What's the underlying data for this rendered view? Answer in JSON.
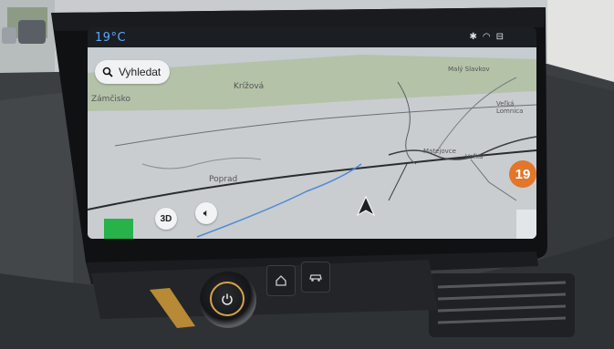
{
  "status_bar": {
    "temperature": "19°C",
    "icons": [
      "bluetooth-icon",
      "wifi-icon",
      "car-connect-icon"
    ]
  },
  "map": {
    "search_label": "Vyhledat",
    "place_labels": [
      "Zámčisko",
      "Krížová",
      "Malý Slavkov",
      "Veľká Lomnica",
      "Poprad",
      "Matejovce",
      "Veľká"
    ],
    "view_mode_label": "3D",
    "speed_limit": "19"
  },
  "controls": {
    "home_icon": "home-icon",
    "car_icon": "car-icon",
    "power_icon": "power-icon"
  },
  "colors": {
    "temperature": "#5aa8ff",
    "speed_badge": "#e2762a",
    "knob_ring": "#d7a24a"
  }
}
